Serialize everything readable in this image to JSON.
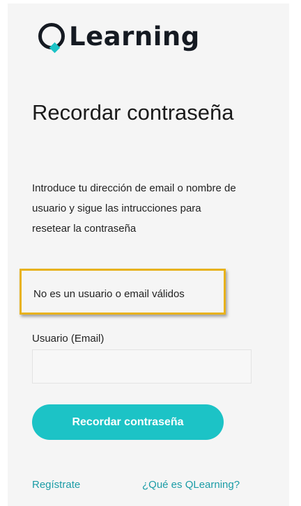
{
  "brand": {
    "logo_text": "Learning",
    "colors": {
      "accent": "#1cc3c6",
      "dark": "#151a22",
      "warning_border": "#e8b21c",
      "link": "#1a9ca6"
    }
  },
  "page": {
    "title": "Recordar contraseña",
    "intro": "Introduce tu dirección de email o nombre de usuario y sigue las intrucciones para resetear la contraseña"
  },
  "error": {
    "message": "No es un usuario o email válidos"
  },
  "form": {
    "username_label": "Usuario (Email)",
    "username_value": "",
    "submit_label": "Recordar contraseña"
  },
  "footer": {
    "register_link": "Regístrate",
    "about_link": "¿Qué es QLearning?"
  },
  "icons": {
    "logo_mark": "qlearning-q-icon"
  }
}
